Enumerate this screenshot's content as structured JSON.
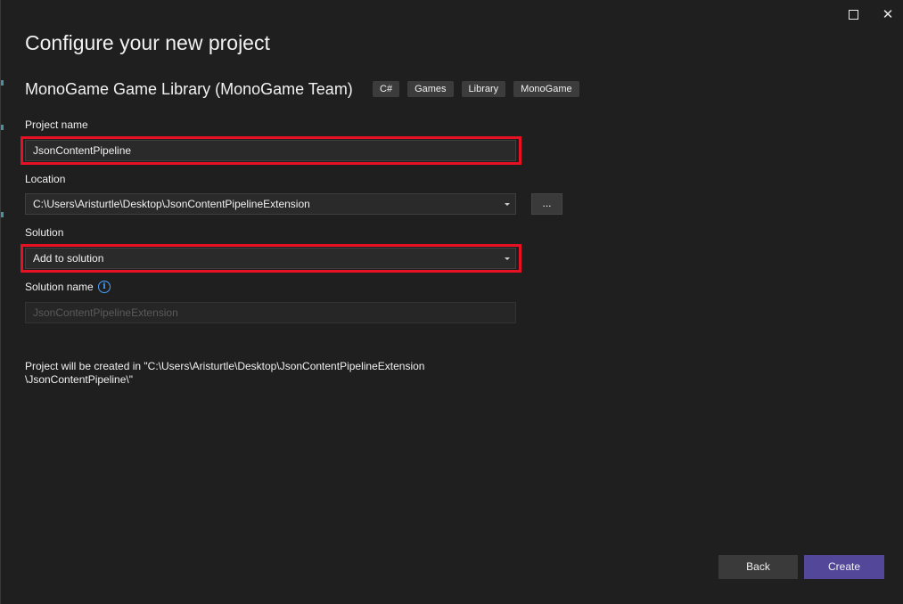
{
  "window": {
    "maximize_label": "",
    "close_label": "✕"
  },
  "header": {
    "title": "Configure your new project",
    "template_name": "MonoGame Game Library (MonoGame Team)",
    "tags": [
      "C#",
      "Games",
      "Library",
      "MonoGame"
    ]
  },
  "form": {
    "project_name": {
      "label": "Project name",
      "value": "JsonContentPipeline"
    },
    "location": {
      "label": "Location",
      "value": "C:\\Users\\Aristurtle\\Desktop\\JsonContentPipelineExtension",
      "browse_label": "..."
    },
    "solution": {
      "label": "Solution",
      "value": "Add to solution"
    },
    "solution_name": {
      "label": "Solution name",
      "placeholder": "JsonContentPipelineExtension",
      "info_icon": "i"
    }
  },
  "path_note": {
    "line1": "Project will be created in \"C:\\Users\\Aristurtle\\Desktop\\JsonContentPipelineExtension",
    "line2": "\\JsonContentPipeline\\\""
  },
  "footer": {
    "back_label": "Back",
    "create_label": "Create"
  },
  "colors": {
    "highlight": "#e81123",
    "primary_button": "#524798",
    "info_icon": "#4aa3ff"
  }
}
